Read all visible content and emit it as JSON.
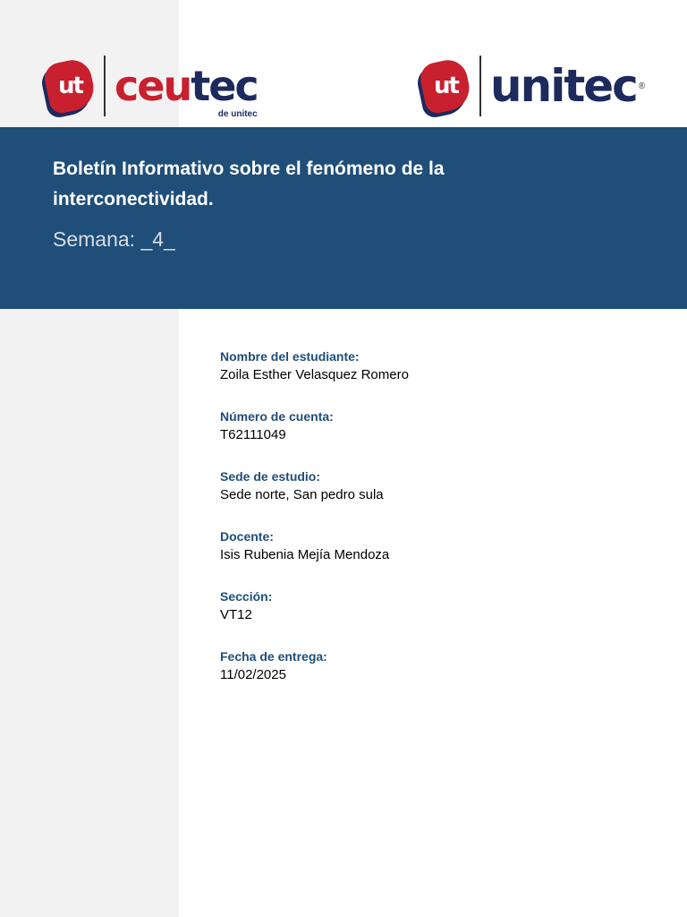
{
  "logos": {
    "ceutec": {
      "part1": "ceu",
      "part2": "tec",
      "subtitle": "de unitec",
      "badge": "ut"
    },
    "unitec": {
      "word": "unitec",
      "badge": "ut",
      "registered": "®"
    }
  },
  "header": {
    "title": "Boletín Informativo sobre el fenómeno de la interconectividad.",
    "week": "Semana: _4_"
  },
  "fields": [
    {
      "label": "Nombre del estudiante:",
      "value": "Zoila Esther Velasquez Romero"
    },
    {
      "label": "Número de cuenta:",
      "value": "T62111049"
    },
    {
      "label": "Sede de estudio:",
      "value": "Sede norte, San pedro sula"
    },
    {
      "label": "Docente:",
      "value": "Isis Rubenia Mejía Mendoza"
    },
    {
      "label": "Sección:",
      "value": "VT12"
    },
    {
      "label": "Fecha de entrega:",
      "value": "11/02/2025"
    }
  ],
  "colors": {
    "band": "#1f4e79",
    "label": "#1f4e79",
    "brand_red": "#c8202f",
    "brand_navy": "#1c2a5e"
  }
}
